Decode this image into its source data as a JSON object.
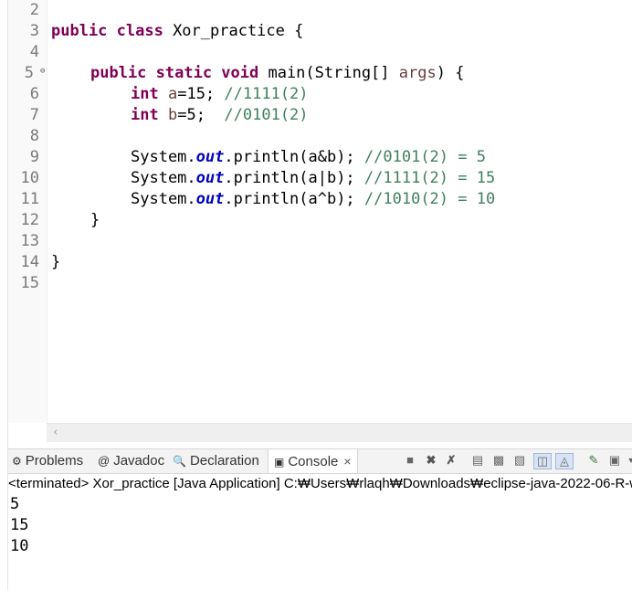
{
  "editor": {
    "line_numbers": [
      "2",
      "3",
      "4",
      "5",
      "6",
      "7",
      "8",
      "9",
      "10",
      "11",
      "12",
      "13",
      "14",
      "15"
    ],
    "lines": {
      "l3": {
        "kw": "public class",
        "rest": " Xor_practice {"
      },
      "l5": {
        "kw": "public static void",
        "rest": " main(String[] ",
        "param": "args",
        "end": ") {"
      },
      "l6": {
        "kw": "int",
        "rest": " ",
        "var": "a",
        "code": "=15; ",
        "comment": "//1111(2)"
      },
      "l7": {
        "kw": "int",
        "rest": " ",
        "var": "b",
        "code": "=5;  ",
        "comment": "//0101(2)"
      },
      "l9": {
        "pre": "System.",
        "field": "out",
        "mid": ".println(a&b); ",
        "comment": "//0101(2) = 5"
      },
      "l10": {
        "pre": "System.",
        "field": "out",
        "mid": ".println(a|b); ",
        "comment": "//1111(2) = 15"
      },
      "l11": {
        "pre": "System.",
        "field": "out",
        "mid": ".println(a^b); ",
        "comment": "//1010(2) = 10"
      },
      "l12": "}",
      "l14": "}"
    },
    "fold_marker": "⊖"
  },
  "panel": {
    "tabs": {
      "problems": "Problems",
      "javadoc": "Javadoc",
      "declaration": "Declaration",
      "console": "Console",
      "close": "×"
    },
    "status": "<terminated> Xor_practice [Java Application] C:₩Users₩rlaqh₩Downloads₩eclipse-java-2022-06-R-w",
    "output": [
      "5",
      "15",
      "10"
    ]
  },
  "icons": {
    "problems": "problems-icon",
    "javadoc": "javadoc-icon",
    "declaration": "declaration-icon",
    "console": "console-icon"
  },
  "colors": {
    "keyword": "#7f0055",
    "field": "#0000c0",
    "comment": "#3f7f5f"
  }
}
